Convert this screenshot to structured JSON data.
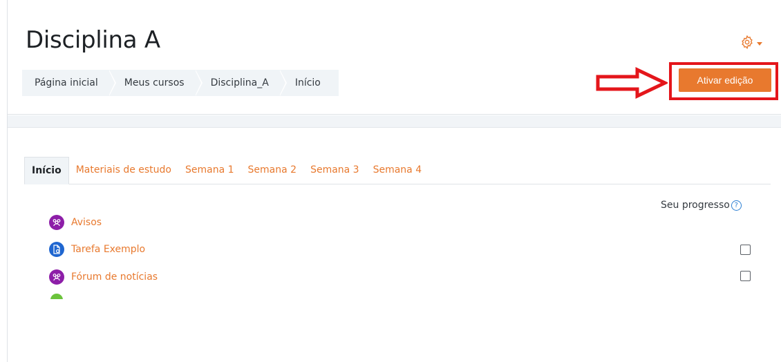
{
  "page": {
    "title": "Disciplina A"
  },
  "breadcrumb": [
    "Página inicial",
    "Meus cursos",
    "Disciplina_A",
    "Início"
  ],
  "header": {
    "edit_button": "Ativar edição",
    "settings_icon": "gear-icon"
  },
  "tabs": [
    {
      "label": "Início",
      "active": true
    },
    {
      "label": "Materiais de estudo",
      "active": false
    },
    {
      "label": "Semana 1",
      "active": false
    },
    {
      "label": "Semana 2",
      "active": false
    },
    {
      "label": "Semana 3",
      "active": false
    },
    {
      "label": "Semana 4",
      "active": false
    }
  ],
  "progress": {
    "label": "Seu progresso",
    "help_icon": "?"
  },
  "activities": [
    {
      "label": "Avisos",
      "icon": "forum-icon",
      "checkbox": false
    },
    {
      "label": "Tarefa Exemplo",
      "icon": "assignment-icon",
      "checkbox": true
    },
    {
      "label": "Fórum de notícias",
      "icon": "forum-icon",
      "checkbox": true
    }
  ],
  "colors": {
    "accent": "#e8792e",
    "highlight": "#e4161b",
    "forum_icon": "#8d1ea8",
    "assignment_icon": "#1f66d0",
    "partial_icon": "#6bc33b"
  }
}
